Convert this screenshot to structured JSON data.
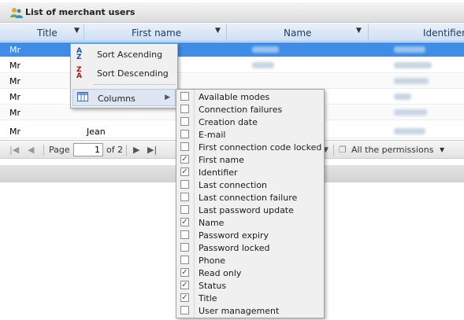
{
  "panel": {
    "title": "List of merchant users"
  },
  "columns": {
    "title": "Title",
    "first_name": "First name",
    "name": "Name",
    "identifier": "Identifier"
  },
  "rows": [
    {
      "title": "Mr",
      "first": "",
      "selected": true
    },
    {
      "title": "Mr",
      "first": ""
    },
    {
      "title": "Mr",
      "first": ""
    },
    {
      "title": "Mr",
      "first": ""
    },
    {
      "title": "Mr",
      "first": ""
    },
    {
      "title": "Mr",
      "first": "Jean"
    }
  ],
  "toolbar": {
    "page_label": "Page",
    "page_value": "1",
    "of_label": "of 2",
    "permissions_label": "All the permissions"
  },
  "column_menu": {
    "sort_asc": "Sort Ascending",
    "sort_desc": "Sort Descending",
    "columns": "Columns"
  },
  "columns_submenu": [
    {
      "label": "Available modes",
      "checked": false
    },
    {
      "label": "Connection failures",
      "checked": false
    },
    {
      "label": "Creation date",
      "checked": false
    },
    {
      "label": "E-mail",
      "checked": false
    },
    {
      "label": "First connection code locked",
      "checked": false
    },
    {
      "label": "First name",
      "checked": true
    },
    {
      "label": "Identifier",
      "checked": true
    },
    {
      "label": "Last connection",
      "checked": false
    },
    {
      "label": "Last connection failure",
      "checked": false
    },
    {
      "label": "Last password update",
      "checked": false
    },
    {
      "label": "Name",
      "checked": true
    },
    {
      "label": "Password expiry",
      "checked": false
    },
    {
      "label": "Password locked",
      "checked": false
    },
    {
      "label": "Phone",
      "checked": false
    },
    {
      "label": "Read only",
      "checked": true
    },
    {
      "label": "Status",
      "checked": true
    },
    {
      "label": "Title",
      "checked": true
    },
    {
      "label": "User management",
      "checked": false
    }
  ],
  "icons": {
    "panel": "users-icon",
    "sort_asc": "sort-ascending-icon",
    "sort_desc": "sort-descending-icon",
    "columns": "columns-icon"
  },
  "colors": {
    "selection": "#3f8de4",
    "header": "#cfdff3",
    "menu": "#f0f0f0"
  }
}
